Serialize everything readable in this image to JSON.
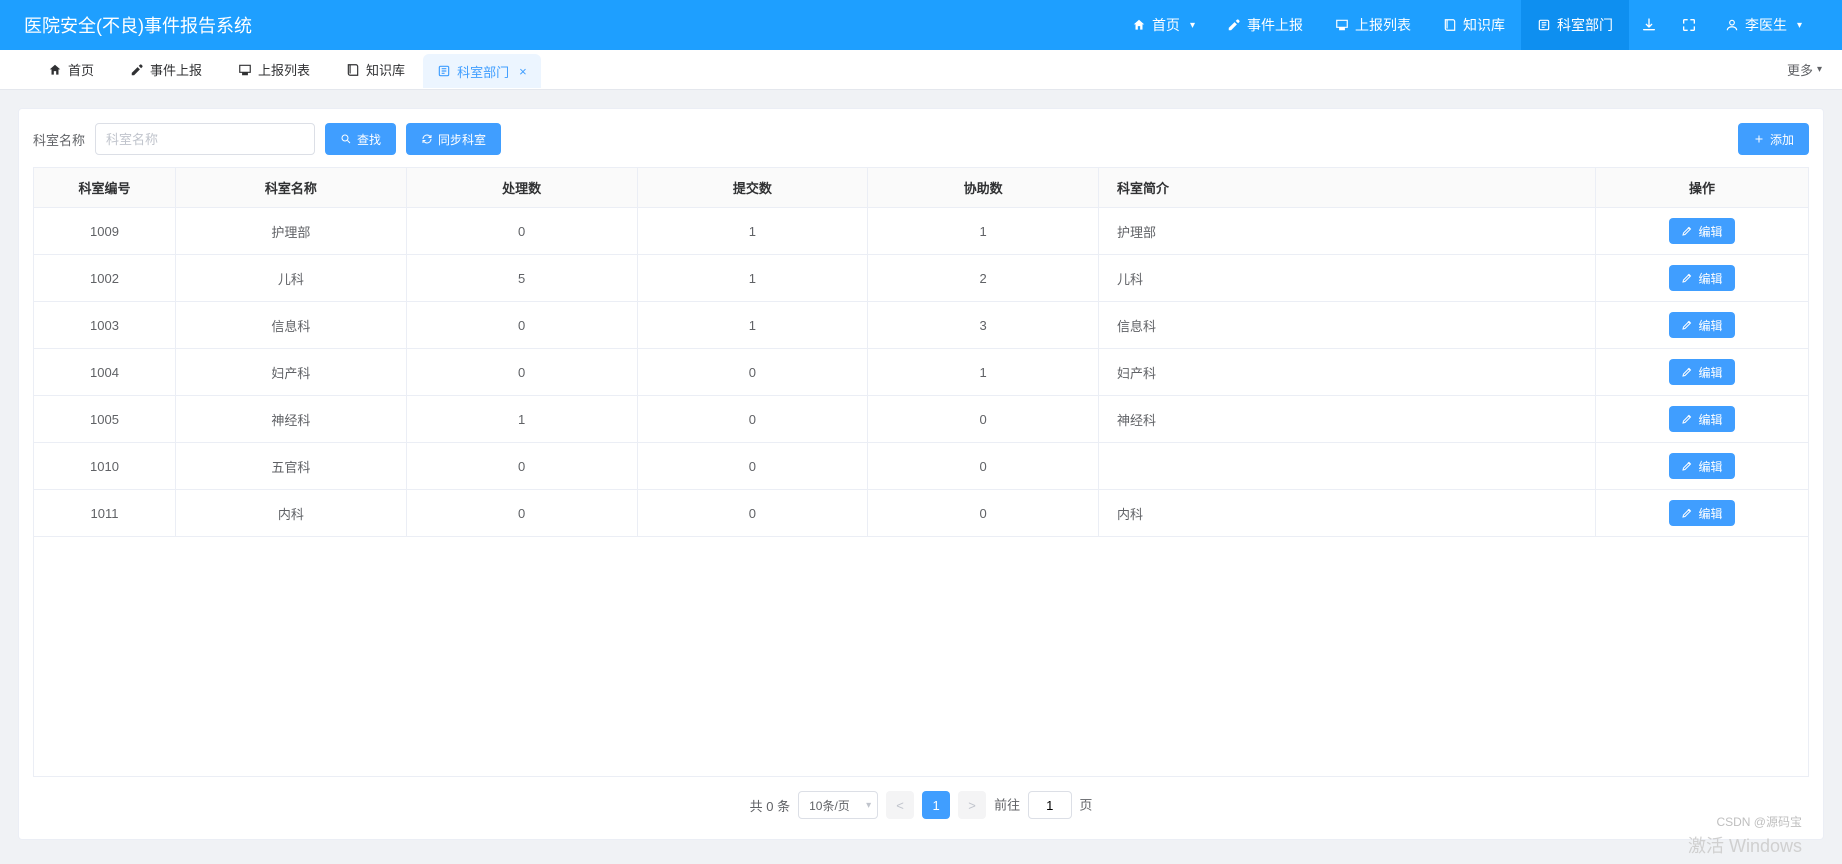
{
  "brand": "医院安全(不良)事件报告系统",
  "topnav": {
    "items": [
      {
        "label": "首页",
        "icon": "home",
        "caret": true,
        "active": false
      },
      {
        "label": "事件上报",
        "icon": "edit",
        "caret": false,
        "active": false
      },
      {
        "label": "上报列表",
        "icon": "monitor",
        "caret": false,
        "active": false
      },
      {
        "label": "知识库",
        "icon": "book",
        "caret": false,
        "active": false
      },
      {
        "label": "科室部门",
        "icon": "dept",
        "caret": false,
        "active": true
      }
    ],
    "user": "李医生",
    "icons": [
      "download",
      "fullscreen"
    ]
  },
  "tabs": {
    "items": [
      {
        "label": "首页",
        "icon": "home",
        "active": false,
        "closable": false
      },
      {
        "label": "事件上报",
        "icon": "edit",
        "active": false,
        "closable": false
      },
      {
        "label": "上报列表",
        "icon": "monitor",
        "active": false,
        "closable": false
      },
      {
        "label": "知识库",
        "icon": "book",
        "active": false,
        "closable": false
      },
      {
        "label": "科室部门",
        "icon": "dept",
        "active": true,
        "closable": true
      }
    ],
    "more": "更多"
  },
  "toolbar": {
    "filter_label": "科室名称",
    "filter_placeholder": "科室名称",
    "search_label": "查找",
    "sync_label": "同步科室",
    "add_label": "添加"
  },
  "table": {
    "columns": [
      "科室编号",
      "科室名称",
      "处理数",
      "提交数",
      "协助数",
      "科室简介",
      "操作"
    ],
    "edit_label": "编辑",
    "rows": [
      {
        "id": "1009",
        "name": "护理部",
        "process": "0",
        "submit": "1",
        "assist": "1",
        "desc": "护理部"
      },
      {
        "id": "1002",
        "name": "儿科",
        "process": "5",
        "submit": "1",
        "assist": "2",
        "desc": "儿科"
      },
      {
        "id": "1003",
        "name": "信息科",
        "process": "0",
        "submit": "1",
        "assist": "3",
        "desc": "信息科"
      },
      {
        "id": "1004",
        "name": "妇产科",
        "process": "0",
        "submit": "0",
        "assist": "1",
        "desc": "妇产科"
      },
      {
        "id": "1005",
        "name": "神经科",
        "process": "1",
        "submit": "0",
        "assist": "0",
        "desc": "神经科"
      },
      {
        "id": "1010",
        "name": "五官科",
        "process": "0",
        "submit": "0",
        "assist": "0",
        "desc": ""
      },
      {
        "id": "1011",
        "name": "内科",
        "process": "0",
        "submit": "0",
        "assist": "0",
        "desc": "内科"
      }
    ]
  },
  "pager": {
    "total_label": "共 0 条",
    "size_label": "10条/页",
    "current": "1",
    "goto_prefix": "前往",
    "goto_value": "1",
    "goto_suffix": "页"
  },
  "watermark": {
    "csdn": "CSDN @源码宝",
    "win": "激活 Windows"
  }
}
